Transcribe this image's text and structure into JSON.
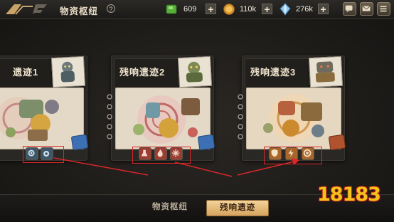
{
  "header": {
    "title": "物资枢纽",
    "help_label": "?",
    "resources": [
      {
        "name": "green-gem",
        "value": "609",
        "plus": "+"
      },
      {
        "name": "coin",
        "value": "110k",
        "plus": "+"
      },
      {
        "name": "crystal",
        "value": "276k",
        "plus": "+"
      }
    ],
    "buttons": [
      "chat-icon",
      "mail-icon",
      "menu-icon"
    ]
  },
  "cards": [
    {
      "title": "遗迹1",
      "icons": [
        "gear-icon",
        "pet-icon"
      ]
    },
    {
      "title": "残响遗迹2",
      "icons": [
        "flask-icon",
        "fire-icon",
        "snowflake-icon"
      ]
    },
    {
      "title": "残响遗迹3",
      "icons": [
        "shield-icon",
        "bolt-icon",
        "wind-icon"
      ]
    }
  ],
  "tabs": [
    {
      "label": "物资枢纽",
      "active": false
    },
    {
      "label": "残响遗迹",
      "active": true
    }
  ],
  "watermark": "18183",
  "colors": {
    "accent": "#d6a35e",
    "highlight": "#d8262a",
    "paper": "#e3d9c6"
  }
}
